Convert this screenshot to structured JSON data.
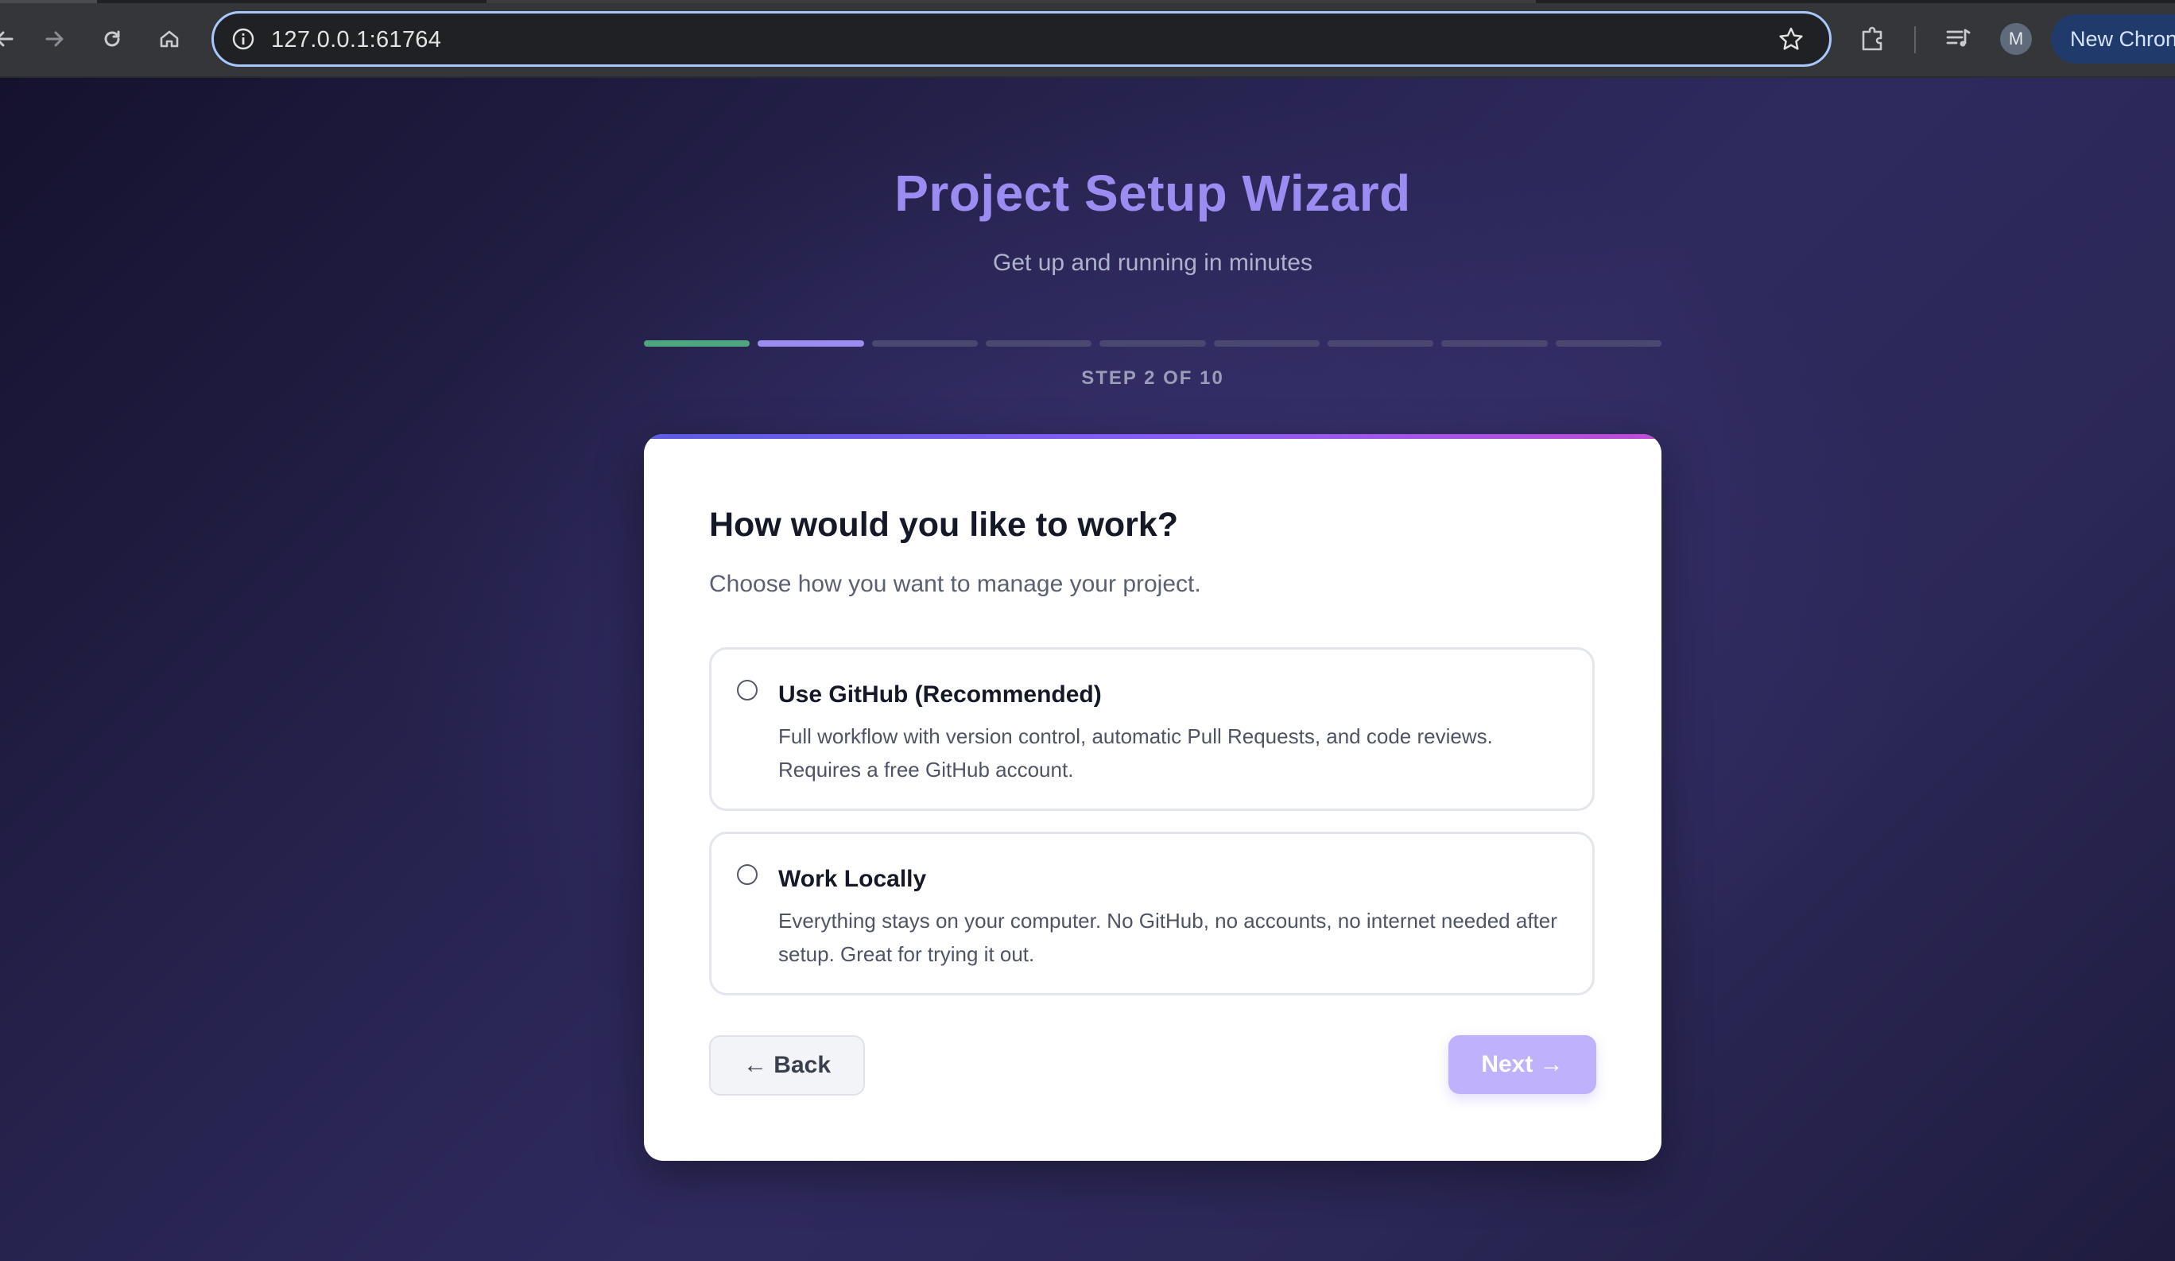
{
  "browser": {
    "url": "127.0.0.1:61764",
    "avatar_initial": "M",
    "new_chrome_label": "New Chron",
    "icons": [
      "back-arrow-icon",
      "forward-arrow-icon",
      "reload-icon",
      "home-icon",
      "info-icon",
      "star-icon",
      "extensions-icon",
      "media-icon"
    ]
  },
  "header": {
    "title": "Project Setup Wizard",
    "subtitle": "Get up and running in minutes"
  },
  "progress": {
    "step_label": "STEP 2 OF 10",
    "current_step": 2,
    "total_steps": 10
  },
  "card": {
    "heading": "How would you like to work?",
    "description": "Choose how you want to manage your project.",
    "options": [
      {
        "title": "Use GitHub (Recommended)",
        "description": "Full workflow with version control, automatic Pull Requests, and code reviews. Requires a free GitHub account.",
        "selected": false
      },
      {
        "title": "Work Locally",
        "description": "Everything stays on your computer. No GitHub, no accounts, no internet needed after setup. Great for trying it out.",
        "selected": false
      }
    ],
    "back_label": "← Back",
    "next_label": "Next →"
  },
  "colors": {
    "title": "#9b8cf2",
    "progress_done": "#4ea67f",
    "progress_current": "#9b8cf2",
    "progress_pending": "#4a4870",
    "next_button": "#bfb1fb",
    "accent_gradient": [
      "#5b5be6",
      "#8b5cf6",
      "#c04bd6"
    ]
  }
}
